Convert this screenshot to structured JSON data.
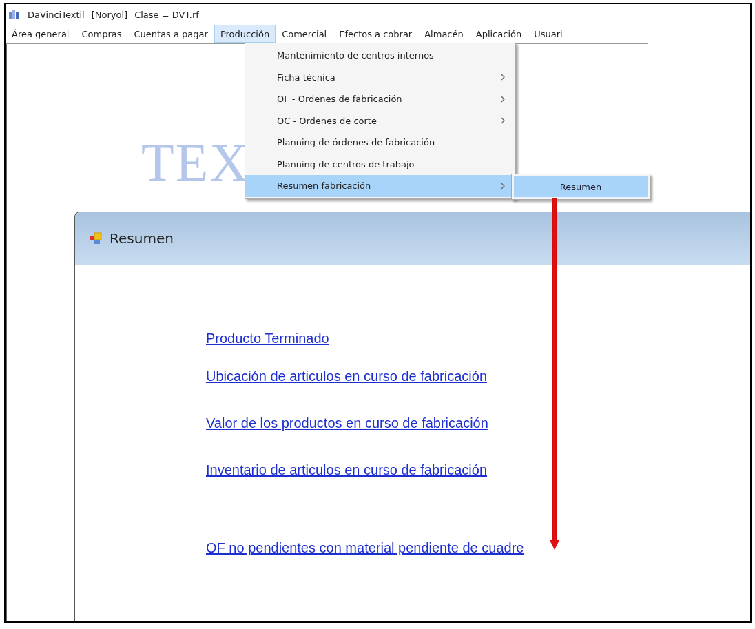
{
  "window": {
    "title": "DaVinciTextil",
    "company": "[Noryol]",
    "class": "Clase = DVT.rf"
  },
  "menu_bar": [
    {
      "label": "Área general",
      "selected": false
    },
    {
      "label": "Compras",
      "selected": false
    },
    {
      "label": "Cuentas a pagar",
      "selected": false
    },
    {
      "label": "Producción",
      "selected": true
    },
    {
      "label": "Comercial",
      "selected": false
    },
    {
      "label": "Efectos a cobrar",
      "selected": false
    },
    {
      "label": "Almacén",
      "selected": false
    },
    {
      "label": "Aplicación",
      "selected": false
    },
    {
      "label": "Usuari",
      "selected": false
    }
  ],
  "background_logo": "TEX",
  "dropdown": [
    {
      "label": "Mantenimiento de centros internos",
      "submenu": false,
      "selected": false
    },
    {
      "label": "Ficha técnica",
      "submenu": true,
      "selected": false
    },
    {
      "label": "OF - Ordenes de fabricación",
      "submenu": true,
      "selected": false
    },
    {
      "label": "OC - Ordenes de corte",
      "submenu": true,
      "selected": false
    },
    {
      "label": "Planning de órdenes de fabricación",
      "submenu": false,
      "selected": false
    },
    {
      "label": "Planning de centros de trabajo",
      "submenu": false,
      "selected": false
    },
    {
      "label": "Resumen fabricación",
      "submenu": true,
      "selected": true
    }
  ],
  "submenu": [
    {
      "label": "Resumen",
      "selected": true
    }
  ],
  "child_window": {
    "title": "Resumen",
    "links": [
      "Producto Terminado",
      "Ubicación de articulos en curso de fabricación",
      "Valor de los productos en curso de fabricación",
      "Inventario de articulos en curso de fabricación",
      "OF no pendientes con material pendiente de cuadre"
    ]
  }
}
